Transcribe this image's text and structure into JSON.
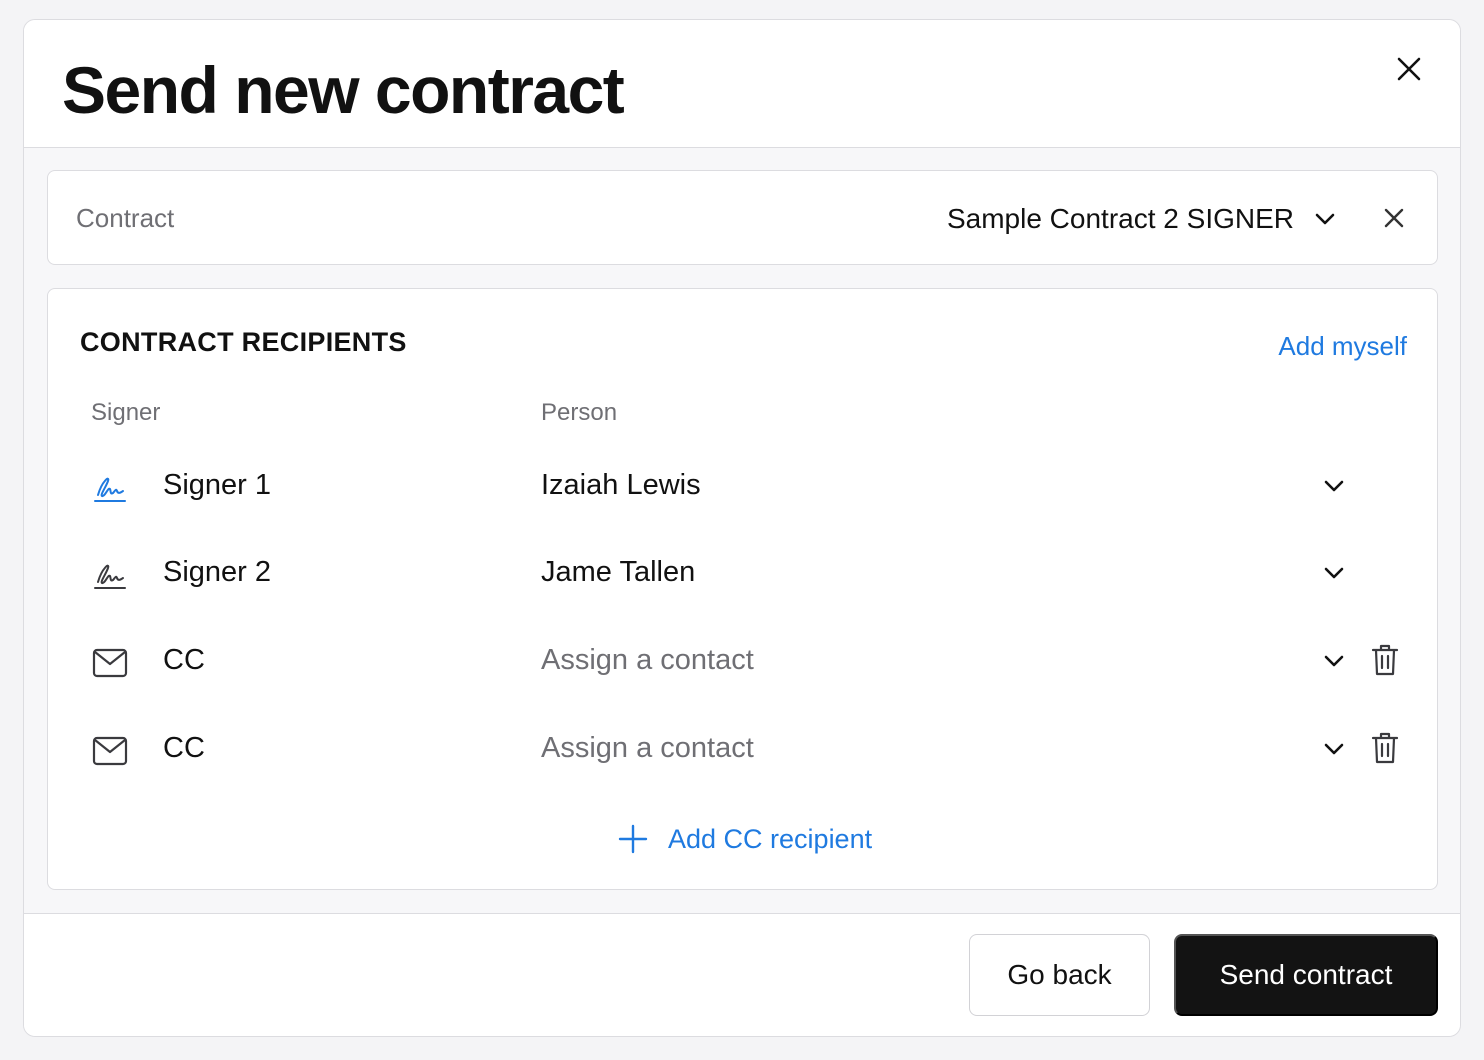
{
  "modal": {
    "title": "Send new contract"
  },
  "contract": {
    "label": "Contract",
    "selected": "Sample Contract 2 SIGNER"
  },
  "recipients": {
    "section_title": "CONTRACT RECIPIENTS",
    "add_myself": "Add myself",
    "columns": {
      "signer": "Signer",
      "person": "Person"
    },
    "rows": [
      {
        "role": "Signer 1",
        "person": "Izaiah Lewis",
        "icon": "signature-icon",
        "icon_color": "#1f7ae0"
      },
      {
        "role": "Signer 2",
        "person": "Jame Tallen",
        "icon": "signature-icon",
        "icon_color": "#3a3a3e"
      },
      {
        "role": "CC",
        "person": "Assign a contact",
        "icon": "mail-icon"
      },
      {
        "role": "CC",
        "person": "Assign a contact",
        "icon": "mail-icon"
      }
    ],
    "add_cc": "Add CC recipient"
  },
  "footer": {
    "go_back": "Go back",
    "send": "Send contract"
  },
  "colors": {
    "accent": "#1f7ae0",
    "primary_button": "#131313"
  }
}
